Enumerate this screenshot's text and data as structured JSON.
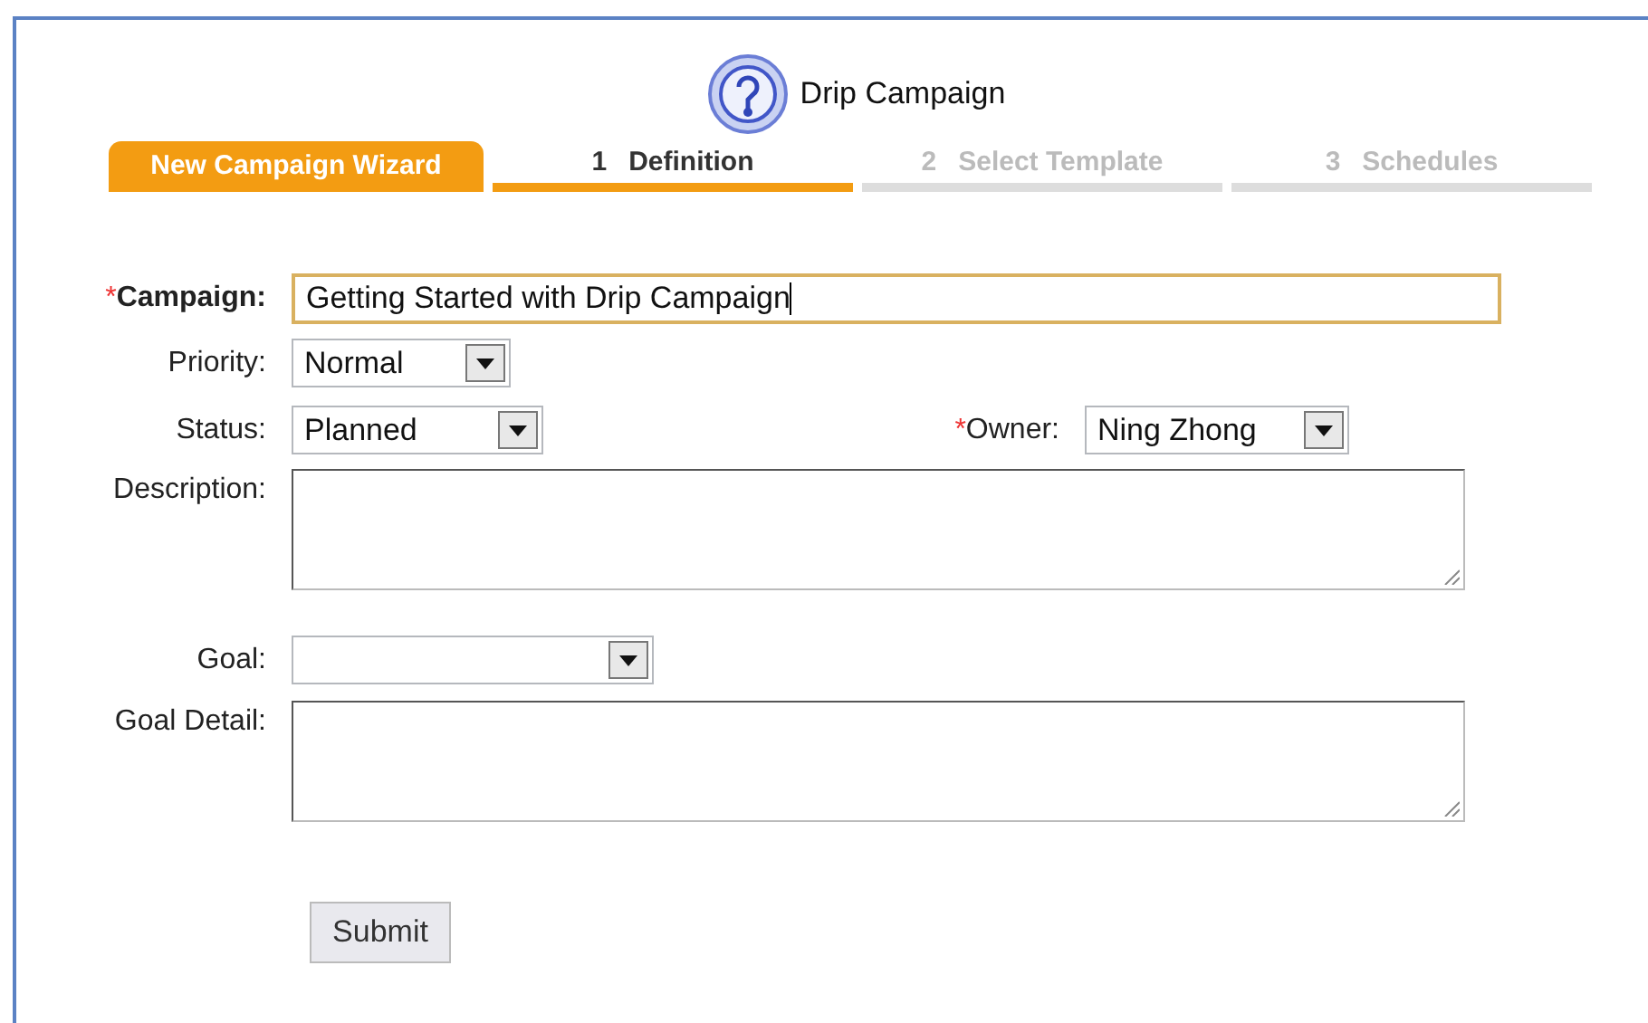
{
  "header": {
    "title": "Drip Campaign"
  },
  "wizard": {
    "label": "New Campaign Wizard",
    "steps": [
      {
        "number": "1",
        "label": "Definition",
        "selected": true
      },
      {
        "number": "2",
        "label": "Select Template",
        "selected": false
      },
      {
        "number": "3",
        "label": "Schedules",
        "selected": false
      }
    ]
  },
  "form": {
    "campaign": {
      "label": "Campaign:",
      "required": true,
      "marker": "*",
      "emphasized": true,
      "value": "Getting Started with Drip Campaign",
      "focused": true
    },
    "priority": {
      "label": "Priority:",
      "value": "Normal"
    },
    "status": {
      "label": "Status:",
      "value": "Planned"
    },
    "owner": {
      "label": "Owner:",
      "required": true,
      "marker": "*",
      "value": "Ning Zhong"
    },
    "description": {
      "label": "Description:"
    },
    "goal": {
      "label": "Goal:"
    },
    "goal_detail": {
      "label": "Goal Detail:"
    },
    "submit": "Submit"
  }
}
